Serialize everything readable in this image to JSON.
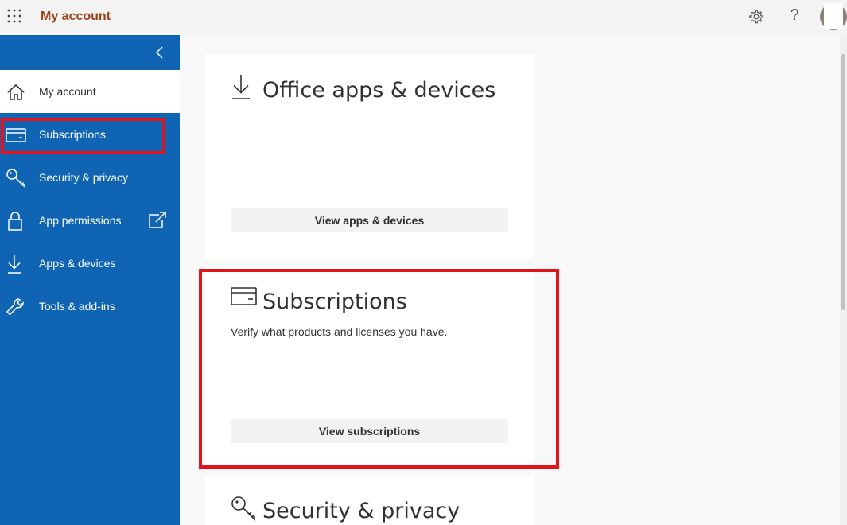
{
  "header": {
    "app_title": "My account",
    "icons": [
      "waffle-icon",
      "gear-icon",
      "help-icon",
      "avatar"
    ],
    "help_glyph": "?"
  },
  "sidebar": {
    "collapse_icon": "chevron-left-icon",
    "items": [
      {
        "label": "My account",
        "icon": "home-icon",
        "active": true
      },
      {
        "label": "Subscriptions",
        "icon": "card-icon",
        "active": false
      },
      {
        "label": "Security & privacy",
        "icon": "key-icon",
        "active": false
      },
      {
        "label": "App permissions",
        "icon": "lock-icon",
        "active": false,
        "external": true
      },
      {
        "label": "Apps & devices",
        "icon": "download-icon",
        "active": false
      },
      {
        "label": "Tools & add-ins",
        "icon": "wrench-icon",
        "active": false
      }
    ]
  },
  "cards": {
    "office": {
      "title": "Office apps & devices",
      "button": "View apps & devices",
      "icon": "download-icon"
    },
    "subscriptions": {
      "title": "Subscriptions",
      "description": "Verify what products and licenses you have.",
      "button": "View subscriptions",
      "icon": "card-icon"
    },
    "security": {
      "title": "Security & privacy",
      "icon": "key-icon"
    }
  },
  "colors": {
    "sidebar_bg": "#0f64b4",
    "title_accent": "#9c4418",
    "highlight": "#e3131c"
  }
}
